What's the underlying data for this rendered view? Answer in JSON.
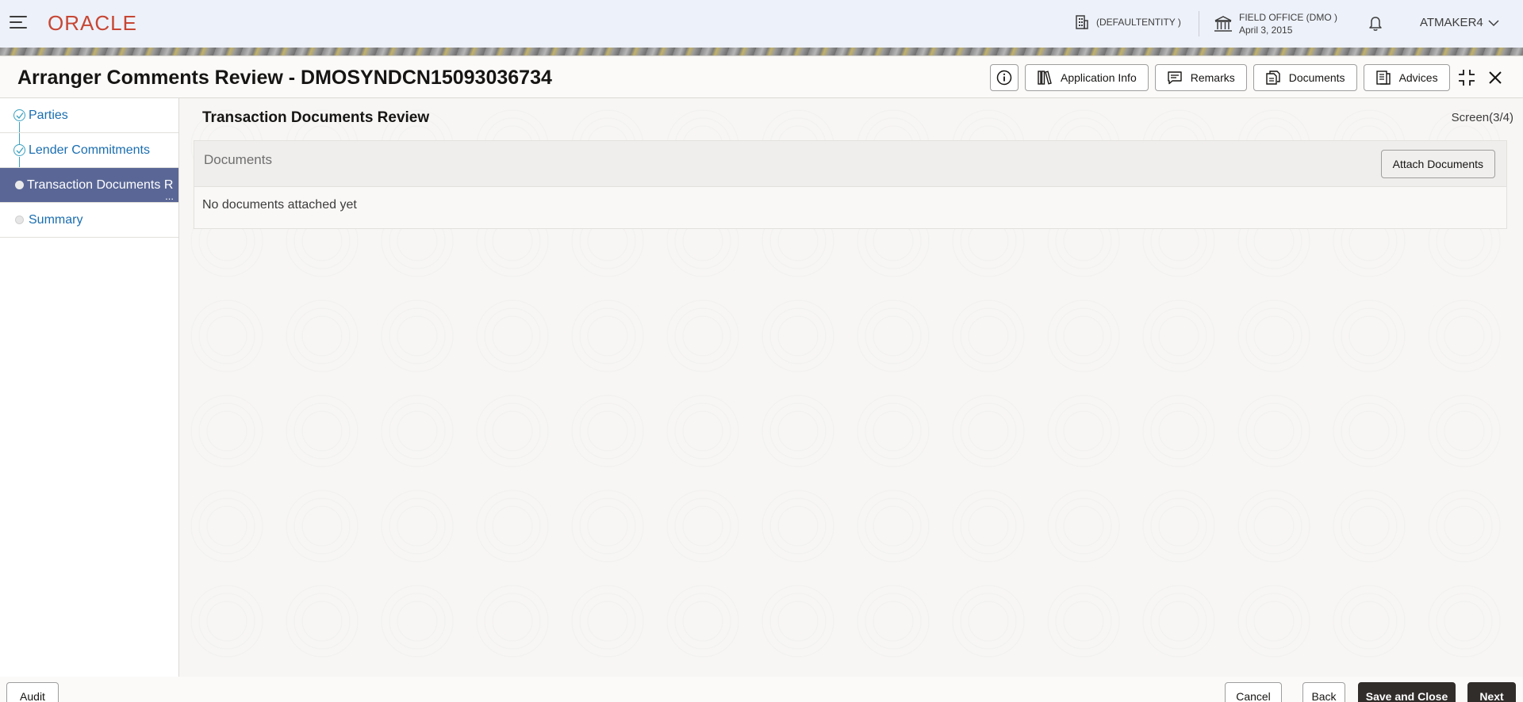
{
  "header": {
    "logo": "ORACLE",
    "entity": "(DEFAULTENTITY )",
    "office_name": "FIELD OFFICE (DMO )",
    "office_date": "April 3, 2015",
    "user": "ATMAKER4"
  },
  "window": {
    "title": "Arranger Comments Review - DMOSYNDCN15093036734",
    "actions": {
      "application_info": "Application Info",
      "remarks": "Remarks",
      "documents": "Documents",
      "advices": "Advices"
    }
  },
  "sidebar": {
    "steps": [
      {
        "label": "Parties",
        "state": "completed"
      },
      {
        "label": "Lender Commitments",
        "state": "completed"
      },
      {
        "label": "Transaction Documents R",
        "state": "active"
      },
      {
        "label": "Summary",
        "state": "pending"
      }
    ],
    "overflow": "..."
  },
  "main": {
    "title": "Transaction Documents Review",
    "screen_count": "Screen(3/4)",
    "documents_label": "Documents",
    "attach_button": "Attach Documents",
    "empty_message": "No documents attached yet"
  },
  "footer": {
    "audit": "Audit",
    "cancel": "Cancel",
    "back": "Back",
    "save_close": "Save and Close",
    "next": "Next"
  },
  "colors": {
    "brand": "#c74634",
    "active_step": "#5a6796",
    "link": "#1a6eb0",
    "primary_button": "#312d2a"
  }
}
